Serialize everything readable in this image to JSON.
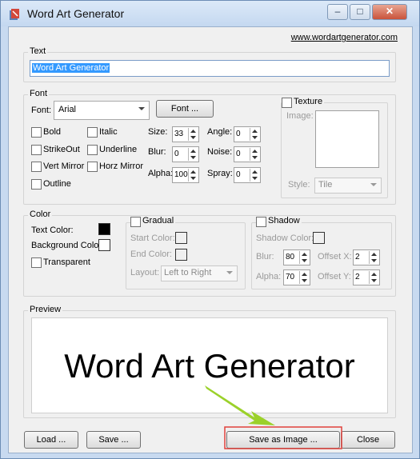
{
  "window": {
    "title": "Word Art Generator",
    "site_link": "www.wordartgenerator.com"
  },
  "titlebar_buttons": {
    "minimize": "–",
    "maximize": "□",
    "close": "✕"
  },
  "text_group": {
    "label": "Text",
    "value": "Word Art Generator"
  },
  "font_group": {
    "label": "Font",
    "font_label": "Font:",
    "font_value": "Arial",
    "font_button": "Font ...",
    "bold": "Bold",
    "italic": "Italic",
    "strikeout": "StrikeOut",
    "underline": "Underline",
    "vert_mirror": "Vert Mirror",
    "horz_mirror": "Horz Mirror",
    "outline": "Outline",
    "size_label": "Size:",
    "size_value": "33",
    "angle_label": "Angle:",
    "angle_value": "0",
    "blur_label": "Blur:",
    "blur_value": "0",
    "noise_label": "Noise:",
    "noise_value": "0",
    "alpha_label": "Alpha:",
    "alpha_value": "100",
    "spray_label": "Spray:",
    "spray_value": "0"
  },
  "texture_group": {
    "label": "Texture",
    "image_label": "Image:",
    "style_label": "Style:",
    "style_value": "Tile"
  },
  "color_group": {
    "label": "Color",
    "text_color_label": "Text Color:",
    "background_color_label": "Background Color",
    "transparent_label": "Transparent",
    "text_color": "#000000",
    "background_color": "#ffffff"
  },
  "gradual_group": {
    "label": "Gradual",
    "start_color_label": "Start Color:",
    "end_color_label": "End Color:",
    "layout_label": "Layout:",
    "layout_value": "Left to Right"
  },
  "shadow_group": {
    "label": "Shadow",
    "shadow_color_label": "Shadow Color:",
    "blur_label": "Blur:",
    "blur_value": "80",
    "offset_x_label": "Offset X:",
    "offset_x_value": "2",
    "alpha_label": "Alpha:",
    "alpha_value": "70",
    "offset_y_label": "Offset Y:",
    "offset_y_value": "2"
  },
  "preview_group": {
    "label": "Preview",
    "text": "Word Art Generator"
  },
  "buttons": {
    "load": "Load ...",
    "save": "Save ...",
    "save_as_image": "Save as Image ...",
    "close": "Close"
  },
  "annotation": {
    "highlight_color": "#e0403a",
    "arrow_color": "#9bd12a"
  }
}
